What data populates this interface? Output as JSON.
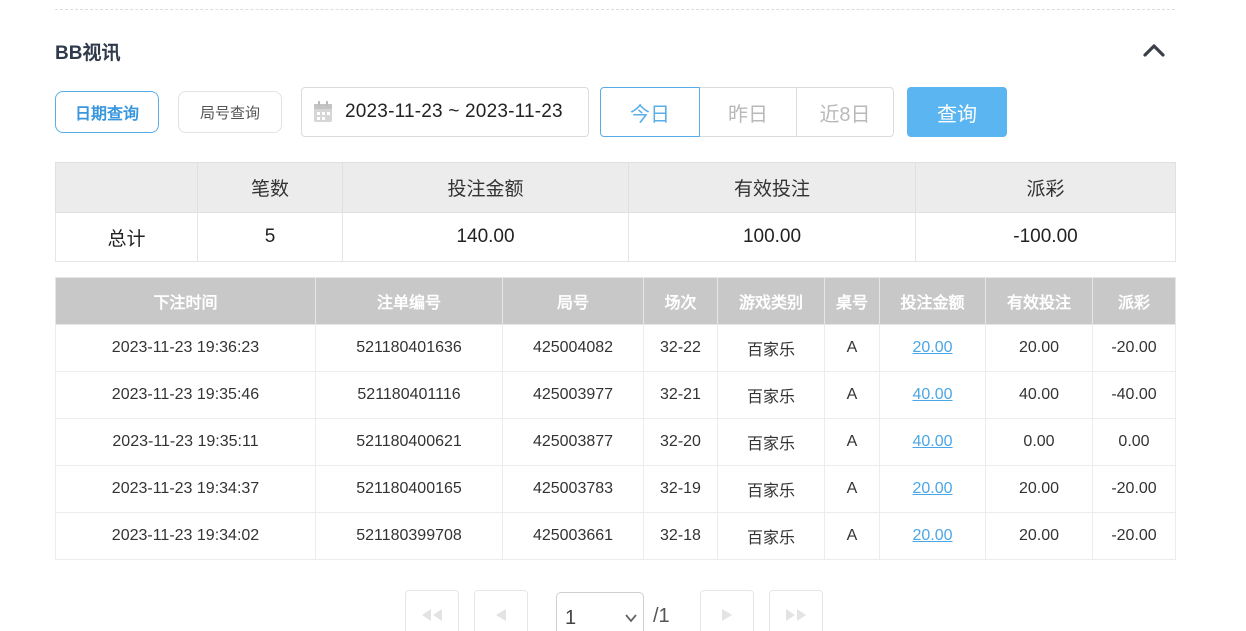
{
  "section": {
    "title": "BB视讯"
  },
  "filters": {
    "date_query_label": "日期查询",
    "round_query_label": "局号查询",
    "date_range": "2023-11-23 ~ 2023-11-23",
    "quick_today": "今日",
    "quick_yesterday": "昨日",
    "quick_last8": "近8日",
    "search_label": "查询"
  },
  "summary": {
    "headers": [
      "",
      "笔数",
      "投注金额",
      "有效投注",
      "派彩"
    ],
    "row": {
      "label": "总计",
      "count": "5",
      "bet": "140.00",
      "valid": "100.00",
      "payout": "-100.00"
    }
  },
  "detail": {
    "headers": [
      "下注时间",
      "注单编号",
      "局号",
      "场次",
      "游戏类别",
      "桌号",
      "投注金额",
      "有效投注",
      "派彩"
    ],
    "rows": [
      {
        "time": "2023-11-23 19:36:23",
        "order": "521180401636",
        "round": "425004082",
        "session": "32-22",
        "game": "百家乐",
        "table": "A",
        "bet": "20.00",
        "valid": "20.00",
        "payout": "-20.00"
      },
      {
        "time": "2023-11-23 19:35:46",
        "order": "521180401116",
        "round": "425003977",
        "session": "32-21",
        "game": "百家乐",
        "table": "A",
        "bet": "40.00",
        "valid": "40.00",
        "payout": "-40.00"
      },
      {
        "time": "2023-11-23 19:35:11",
        "order": "521180400621",
        "round": "425003877",
        "session": "32-20",
        "game": "百家乐",
        "table": "A",
        "bet": "40.00",
        "valid": "0.00",
        "payout": "0.00"
      },
      {
        "time": "2023-11-23 19:34:37",
        "order": "521180400165",
        "round": "425003783",
        "session": "32-19",
        "game": "百家乐",
        "table": "A",
        "bet": "20.00",
        "valid": "20.00",
        "payout": "-20.00"
      },
      {
        "time": "2023-11-23 19:34:02",
        "order": "521180399708",
        "round": "425003661",
        "session": "32-18",
        "game": "百家乐",
        "table": "A",
        "bet": "20.00",
        "valid": "20.00",
        "payout": "-20.00"
      }
    ]
  },
  "pagination": {
    "current": "1",
    "total": "/1"
  },
  "colors": {
    "accent": "#5bb5f0",
    "negative": "#e04848",
    "link": "#4ba6e6"
  },
  "icons": [
    "chevron-up-icon",
    "calendar-icon",
    "first-page-icon",
    "prev-page-icon",
    "next-page-icon",
    "last-page-icon",
    "chevron-down-icon"
  ]
}
